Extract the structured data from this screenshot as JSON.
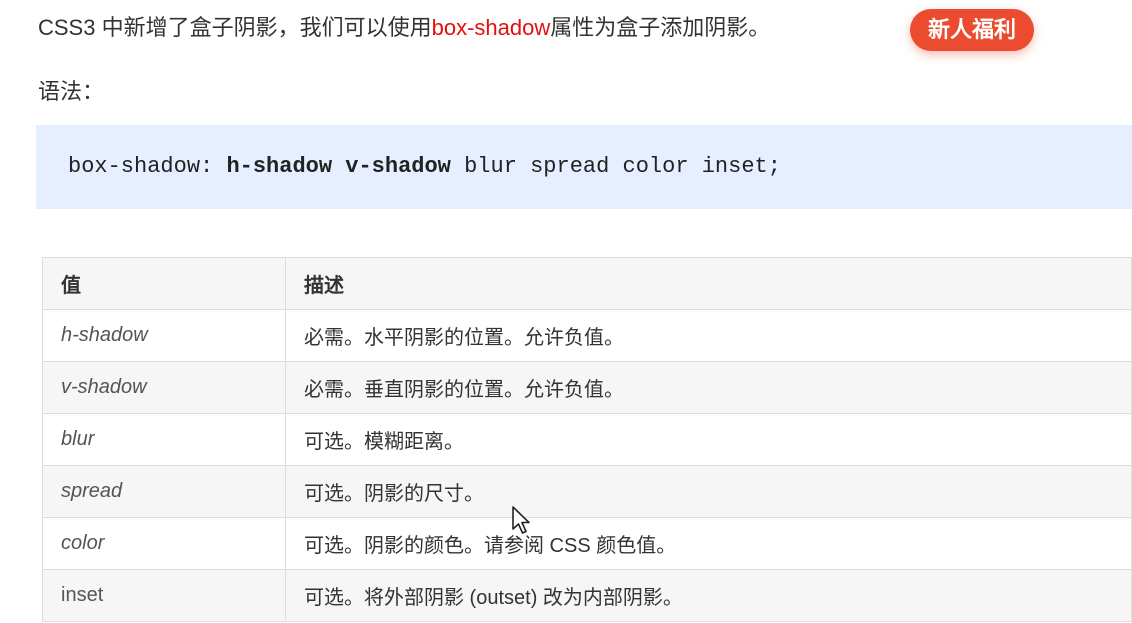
{
  "intro": {
    "prefix": "CSS3 中新增了盒子阴影，我们可以使用",
    "property": "box-shadow",
    "suffix": "属性为盒子添加阴影。"
  },
  "promo": {
    "label": "新人福利"
  },
  "syntax": {
    "label": "语法：",
    "code_prefix": "box-shadow:",
    "code_bold_1": "h-shadow",
    "code_bold_2": "v-shadow",
    "code_rest": "blur spread color inset;"
  },
  "table": {
    "headers": [
      "值",
      "描述"
    ],
    "rows": [
      {
        "value": "h-shadow",
        "desc": "必需。水平阴影的位置。允许负值。"
      },
      {
        "value": "v-shadow",
        "desc": "必需。垂直阴影的位置。允许负值。"
      },
      {
        "value": "blur",
        "desc": "可选。模糊距离。"
      },
      {
        "value": "spread",
        "desc": "可选。阴影的尺寸。"
      },
      {
        "value": "color",
        "desc": "可选。阴影的颜色。请参阅 CSS 颜色值。"
      },
      {
        "value": "inset",
        "desc": "可选。将外部阴影 (outset) 改为内部阴影。"
      }
    ]
  },
  "colors": {
    "highlight": "#e3100f",
    "promo_bg": "#eb4b2e",
    "code_bg": "#e6efff",
    "table_alt_bg": "#f6f6f6",
    "border": "#dddddd"
  },
  "icons": {
    "cursor": "mouse-pointer-icon"
  }
}
